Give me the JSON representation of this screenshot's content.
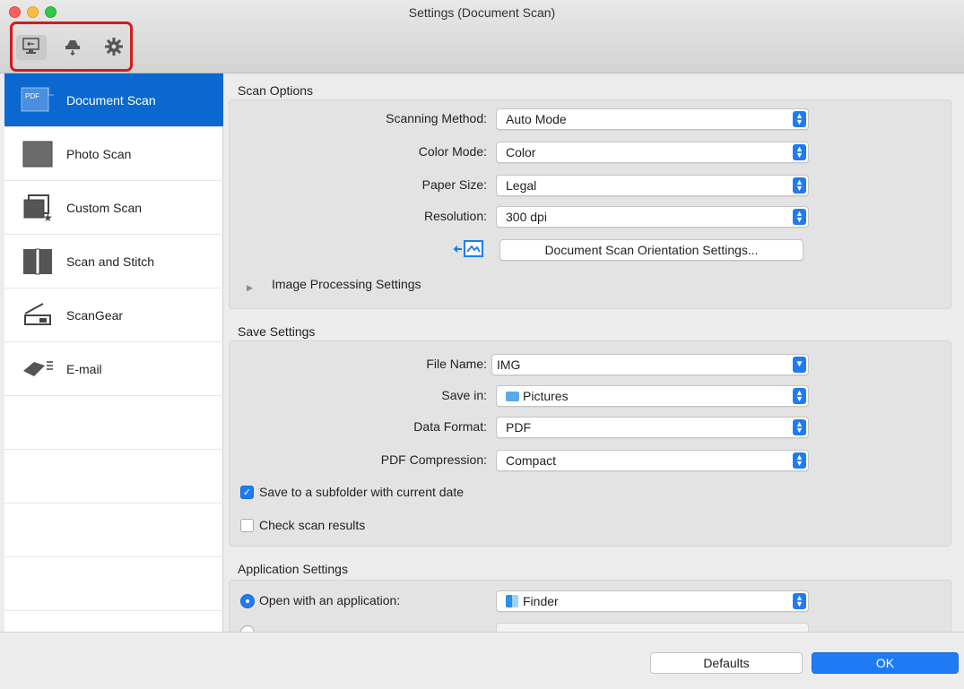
{
  "window": {
    "title": "Settings (Document Scan)"
  },
  "toolbar": {
    "items": [
      {
        "icon": "scan-from-computer-icon"
      },
      {
        "icon": "scan-from-panel-icon"
      },
      {
        "icon": "general-settings-gear-icon"
      }
    ]
  },
  "sidebar": {
    "items": [
      {
        "label": "Document Scan",
        "icon": "pdf-document-icon",
        "selected": true
      },
      {
        "label": "Photo Scan",
        "icon": "photo-icon"
      },
      {
        "label": "Custom Scan",
        "icon": "custom-scan-icon"
      },
      {
        "label": "Scan and Stitch",
        "icon": "stitch-icon"
      },
      {
        "label": "ScanGear",
        "icon": "scanner-icon"
      },
      {
        "label": "E-mail",
        "icon": "email-icon"
      }
    ]
  },
  "scan_options": {
    "title": "Scan Options",
    "scanning_method": {
      "label": "Scanning Method:",
      "value": "Auto Mode"
    },
    "color_mode": {
      "label": "Color Mode:",
      "value": "Color"
    },
    "paper_size": {
      "label": "Paper Size:",
      "value": "Legal"
    },
    "resolution": {
      "label": "Resolution:",
      "value": "300 dpi"
    },
    "orientation_button": "Document Scan Orientation Settings...",
    "image_processing": "Image Processing Settings"
  },
  "save_settings": {
    "title": "Save Settings",
    "file_name": {
      "label": "File Name:",
      "value": "IMG"
    },
    "save_in": {
      "label": "Save in:",
      "value": "Pictures"
    },
    "data_format": {
      "label": "Data Format:",
      "value": "PDF"
    },
    "pdf_compression": {
      "label": "PDF Compression:",
      "value": "Compact"
    },
    "subfolder": {
      "label": "Save to a subfolder with current date",
      "checked": true
    },
    "check_results": {
      "label": "Check scan results",
      "checked": false
    }
  },
  "app_settings": {
    "title": "Application Settings",
    "open_with": {
      "label": "Open with an application:",
      "value": "Finder",
      "selected": true
    }
  },
  "footer": {
    "defaults": "Defaults",
    "ok": "OK"
  },
  "colors": {
    "accent": "#1f7bf4",
    "selection": "#0b68d0",
    "highlight_border": "#d7191b"
  }
}
